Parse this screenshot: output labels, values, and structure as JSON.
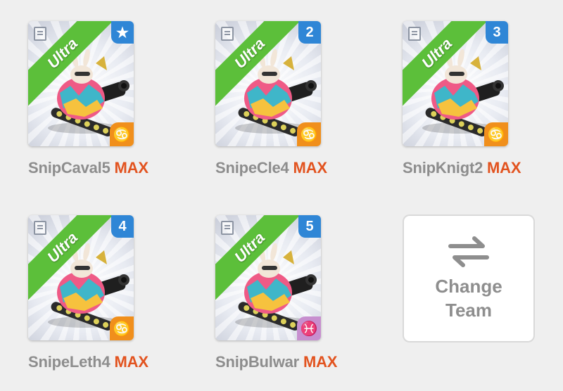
{
  "units": [
    {
      "name": "SnipCaval5",
      "level": "MAX",
      "rarity": "Ultra",
      "rank": "★",
      "rank_icon": "star-icon",
      "class_icon": "cancer-icon",
      "class_symbol": "♋",
      "class_color": "#f08f1c"
    },
    {
      "name": "SnipeCle4",
      "level": "MAX",
      "rarity": "Ultra",
      "rank": "2",
      "rank_icon": "rank-number",
      "class_icon": "cancer-icon",
      "class_symbol": "♋",
      "class_color": "#f08f1c"
    },
    {
      "name": "SnipKnigt2",
      "level": "MAX",
      "rarity": "Ultra",
      "rank": "3",
      "rank_icon": "rank-number",
      "class_icon": "cancer-icon",
      "class_symbol": "♋",
      "class_color": "#f08f1c"
    },
    {
      "name": "SnipeLeth4",
      "level": "MAX",
      "rarity": "Ultra",
      "rank": "4",
      "rank_icon": "rank-number",
      "class_icon": "cancer-icon",
      "class_symbol": "♋",
      "class_color": "#f08f1c"
    },
    {
      "name": "SnipBulwar",
      "level": "MAX",
      "rarity": "Ultra",
      "rank": "5",
      "rank_icon": "rank-number",
      "class_icon": "pisces-icon",
      "class_symbol": "♓",
      "class_color": "#c78fcf"
    }
  ],
  "change_team": {
    "label": "Change Team",
    "icon": "swap-arrows-icon"
  },
  "colors": {
    "ribbon": "#5cbf3a",
    "rank_badge": "#2f86d6",
    "max_text": "#e2531f",
    "name_text": "#8d8d8d",
    "background": "#efefef"
  }
}
